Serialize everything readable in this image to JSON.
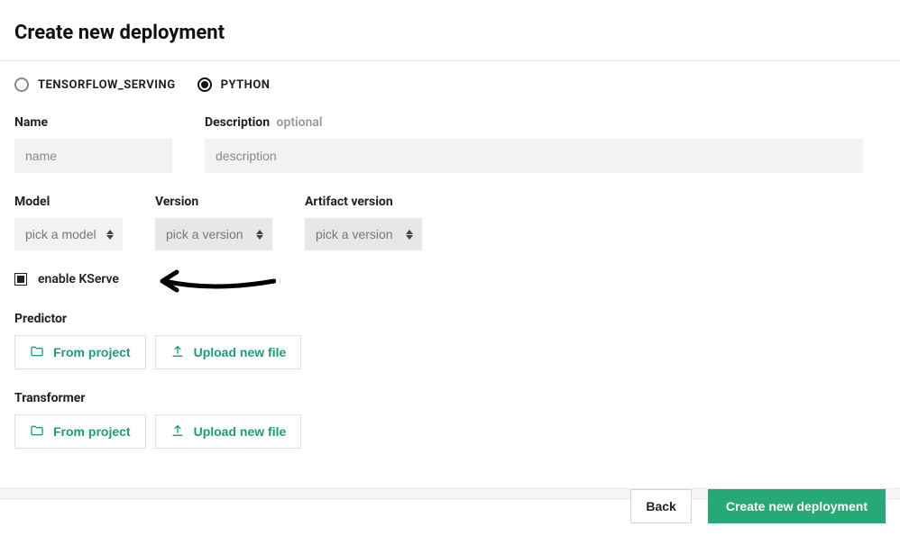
{
  "header": {
    "title": "Create new deployment"
  },
  "serving": {
    "options": [
      {
        "label": "TENSORFLOW_SERVING",
        "selected": false
      },
      {
        "label": "PYTHON",
        "selected": true
      }
    ]
  },
  "fields": {
    "name": {
      "label": "Name",
      "placeholder": "name",
      "value": ""
    },
    "description": {
      "label": "Description",
      "optional": "optional",
      "placeholder": "description",
      "value": ""
    },
    "model": {
      "label": "Model",
      "placeholder": "pick a model"
    },
    "version": {
      "label": "Version",
      "placeholder": "pick a version"
    },
    "artifact": {
      "label": "Artifact version",
      "placeholder": "pick a version"
    }
  },
  "kserve": {
    "label": "enable KServe",
    "checked": true
  },
  "predictor": {
    "label": "Predictor",
    "from_project": "From project",
    "upload": "Upload new file"
  },
  "transformer": {
    "label": "Transformer",
    "from_project": "From project",
    "upload": "Upload new file"
  },
  "footer": {
    "back": "Back",
    "create": "Create new deployment"
  },
  "colors": {
    "primary": "#27a877",
    "accent_text": "#1b9e77"
  }
}
